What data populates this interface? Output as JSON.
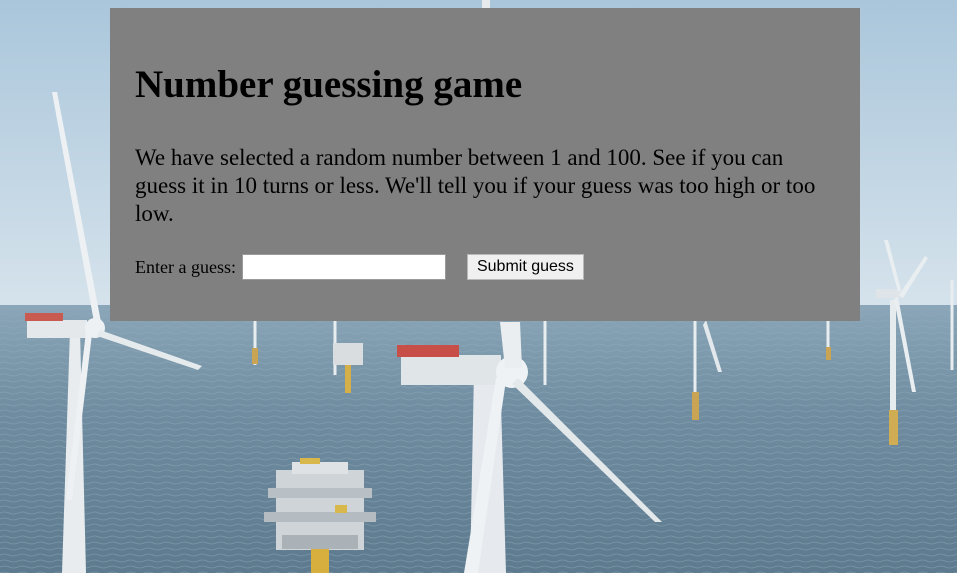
{
  "game": {
    "title": "Number guessing game",
    "intro": "We have selected a random number between 1 and 100. See if you can guess it in 10 turns or less. We'll tell you if your guess was too high or too low.",
    "guess_label": "Enter a guess:",
    "guess_value": "",
    "submit_label": "Submit guess"
  },
  "colors": {
    "panel_background": "#808080",
    "sky": "#c8dae7",
    "sea": "#6e8ba0"
  },
  "background": {
    "subject": "offshore wind farm with turbines and substation platforms"
  }
}
